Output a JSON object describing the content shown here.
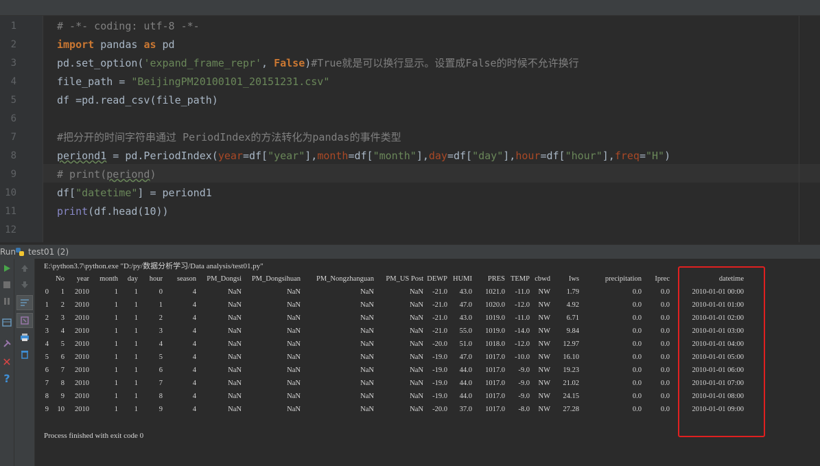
{
  "editor": {
    "line_numbers": [
      "1",
      "2",
      "3",
      "4",
      "5",
      "6",
      "7",
      "8",
      "9",
      "10",
      "11",
      "12"
    ],
    "line1": "# -*- coding: utf-8 -*-",
    "line2": {
      "kw_import": "import",
      "mod": " pandas ",
      "kw_as": "as",
      "alias": " pd"
    },
    "line3": {
      "a": "pd.set_option(",
      "s": "'expand_frame_repr'",
      "b": ", ",
      "kw": "False",
      "c": ")",
      "cmt": "#True就是可以换行显示。设置成False的时候不允许换行"
    },
    "line4": {
      "a": "file_path = ",
      "s": "\"BeijingPM20100101_20151231.csv\""
    },
    "line5": "df =pd.read_csv(file_path)",
    "line7": "#把分开的时间字符串通过 PeriodIndex的方法转化为pandas的事件类型",
    "line8": {
      "var": "periond1",
      "a": " = pd.PeriodIndex(",
      "p1": "year",
      "b": "=df[",
      "s1": "\"year\"",
      "c": "],",
      "p2": "month",
      "d": "=df[",
      "s2": "\"month\"",
      "e": "],",
      "p3": "day",
      "f": "=df[",
      "s3": "\"day\"",
      "g": "],",
      "p4": "hour",
      "h": "=df[",
      "s4": "\"hour\"",
      "i": "],",
      "p5": "freq",
      "j": "=",
      "s5": "\"H\"",
      "k": ")"
    },
    "line9": {
      "a": "# print(",
      "b": "periond",
      ")": ")"
    },
    "line10": {
      "a": "df[",
      "s": "\"datetime\"",
      "b": "] = periond1"
    },
    "line11": {
      "fn": "print",
      "a": "(df.head(10))"
    }
  },
  "run_panel": {
    "label": "Run",
    "tab": "test01 (2)"
  },
  "console": {
    "command": "E:\\python3.7\\python.exe \"D:/py/数据分析学习/Data analysis/test01.py\"",
    "columns": [
      "No",
      "year",
      "month",
      "day",
      "hour",
      "season",
      "PM_Dongsi",
      "PM_Dongsihuan",
      "PM_Nongzhanguan",
      "PM_US Post",
      "DEWP",
      "HUMI",
      "PRES",
      "TEMP",
      "cbwd",
      "Iws",
      "precipitation",
      "Iprec",
      "datetime"
    ],
    "rows": [
      [
        "0",
        "1",
        "2010",
        "1",
        "1",
        "0",
        "4",
        "NaN",
        "NaN",
        "NaN",
        "NaN",
        "-21.0",
        "43.0",
        "1021.0",
        "-11.0",
        "NW",
        "1.79",
        "0.0",
        "0.0",
        "2010-01-01 00:00"
      ],
      [
        "1",
        "2",
        "2010",
        "1",
        "1",
        "1",
        "4",
        "NaN",
        "NaN",
        "NaN",
        "NaN",
        "-21.0",
        "47.0",
        "1020.0",
        "-12.0",
        "NW",
        "4.92",
        "0.0",
        "0.0",
        "2010-01-01 01:00"
      ],
      [
        "2",
        "3",
        "2010",
        "1",
        "1",
        "2",
        "4",
        "NaN",
        "NaN",
        "NaN",
        "NaN",
        "-21.0",
        "43.0",
        "1019.0",
        "-11.0",
        "NW",
        "6.71",
        "0.0",
        "0.0",
        "2010-01-01 02:00"
      ],
      [
        "3",
        "4",
        "2010",
        "1",
        "1",
        "3",
        "4",
        "NaN",
        "NaN",
        "NaN",
        "NaN",
        "-21.0",
        "55.0",
        "1019.0",
        "-14.0",
        "NW",
        "9.84",
        "0.0",
        "0.0",
        "2010-01-01 03:00"
      ],
      [
        "4",
        "5",
        "2010",
        "1",
        "1",
        "4",
        "4",
        "NaN",
        "NaN",
        "NaN",
        "NaN",
        "-20.0",
        "51.0",
        "1018.0",
        "-12.0",
        "NW",
        "12.97",
        "0.0",
        "0.0",
        "2010-01-01 04:00"
      ],
      [
        "5",
        "6",
        "2010",
        "1",
        "1",
        "5",
        "4",
        "NaN",
        "NaN",
        "NaN",
        "NaN",
        "-19.0",
        "47.0",
        "1017.0",
        "-10.0",
        "NW",
        "16.10",
        "0.0",
        "0.0",
        "2010-01-01 05:00"
      ],
      [
        "6",
        "7",
        "2010",
        "1",
        "1",
        "6",
        "4",
        "NaN",
        "NaN",
        "NaN",
        "NaN",
        "-19.0",
        "44.0",
        "1017.0",
        "-9.0",
        "NW",
        "19.23",
        "0.0",
        "0.0",
        "2010-01-01 06:00"
      ],
      [
        "7",
        "8",
        "2010",
        "1",
        "1",
        "7",
        "4",
        "NaN",
        "NaN",
        "NaN",
        "NaN",
        "-19.0",
        "44.0",
        "1017.0",
        "-9.0",
        "NW",
        "21.02",
        "0.0",
        "0.0",
        "2010-01-01 07:00"
      ],
      [
        "8",
        "9",
        "2010",
        "1",
        "1",
        "8",
        "4",
        "NaN",
        "NaN",
        "NaN",
        "NaN",
        "-19.0",
        "44.0",
        "1017.0",
        "-9.0",
        "NW",
        "24.15",
        "0.0",
        "0.0",
        "2010-01-01 08:00"
      ],
      [
        "9",
        "10",
        "2010",
        "1",
        "1",
        "9",
        "4",
        "NaN",
        "NaN",
        "NaN",
        "NaN",
        "-20.0",
        "37.0",
        "1017.0",
        "-8.0",
        "NW",
        "27.28",
        "0.0",
        "0.0",
        "2010-01-01 09:00"
      ]
    ],
    "footer": "Process finished with exit code 0",
    "highlight_color": "#e02020"
  },
  "toolbar_icons": [
    "run-icon",
    "stop-icon",
    "pause-icon",
    "layout-icon",
    "pin-icon",
    "close-icon",
    "help-icon",
    "up-arrow-icon",
    "down-arrow-icon",
    "soft-wrap-icon",
    "scroll-to-end-icon",
    "print-icon",
    "trash-icon"
  ]
}
